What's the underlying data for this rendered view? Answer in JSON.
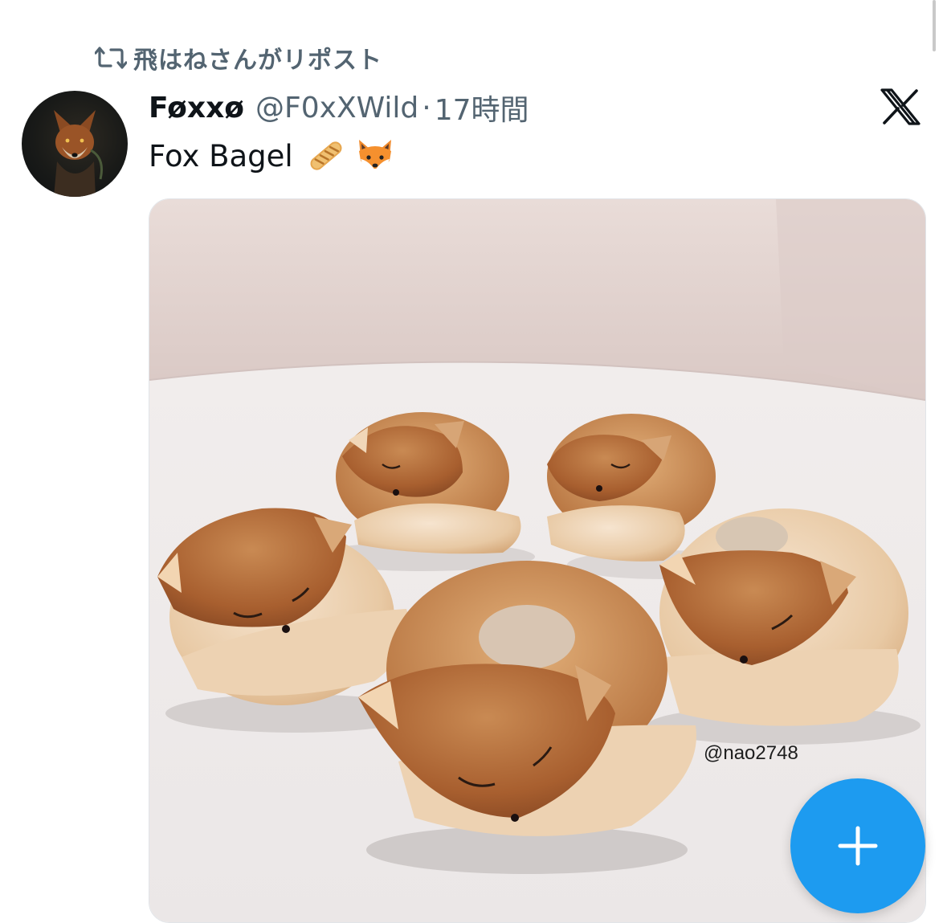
{
  "repost": {
    "label": "飛はねさんがリポスト",
    "icon": "repost-icon"
  },
  "author": {
    "display_name": "Føxxø",
    "handle": "@F0xXWild",
    "separator": "·",
    "time": "17時間",
    "avatar": "fox-avatar"
  },
  "tweet": {
    "text": "Fox Bagel",
    "emojis": [
      "baguette-emoji",
      "fox-face-emoji"
    ]
  },
  "media": {
    "description_icon": "fox-bagel-photo",
    "watermark": "@nao2748"
  },
  "branding": {
    "logo": "x-logo"
  },
  "compose": {
    "icon": "plus-icon"
  },
  "colors": {
    "accent": "#1d9bf0",
    "secondary_text": "#536471",
    "primary_text": "#0f1419"
  }
}
